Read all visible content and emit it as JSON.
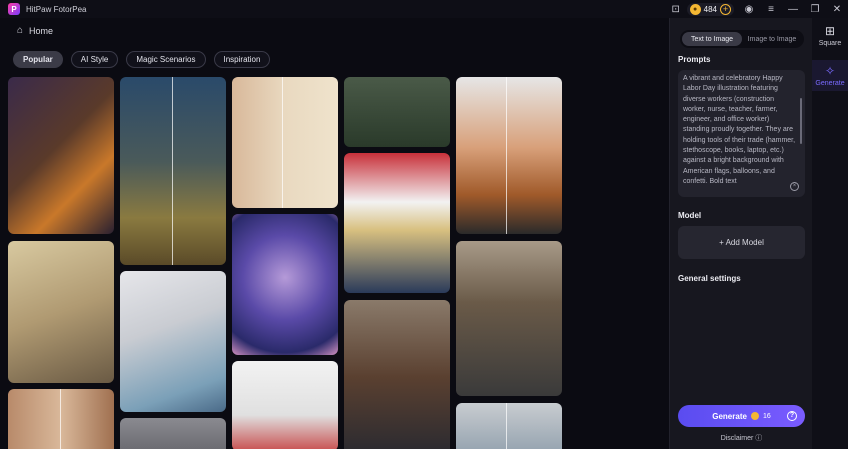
{
  "app": {
    "title": "HitPaw FotorPea",
    "logo_letter": "P"
  },
  "titlebar": {
    "coins": "484",
    "plus": "+",
    "icons": [
      "gamepad-icon",
      "coin-icon",
      "add-coins-icon",
      "account-icon",
      "menu-icon",
      "minimize-icon",
      "restore-icon",
      "close-icon"
    ],
    "gamepad_glyph": "⊡",
    "account_glyph": "◉",
    "menu_glyph": "≡",
    "minimize_glyph": "—",
    "restore_glyph": "❐",
    "close_glyph": "✕"
  },
  "nav": {
    "home_label": "Home",
    "home_glyph": "⌂"
  },
  "tabs": [
    {
      "label": "Popular",
      "active": true
    },
    {
      "label": "AI Style",
      "active": false
    },
    {
      "label": "Magic Scenarios",
      "active": false
    },
    {
      "label": "Inspiration",
      "active": false
    }
  ],
  "panel": {
    "modes": [
      {
        "label": "Text to Image",
        "active": true
      },
      {
        "label": "Image to Image",
        "active": false
      }
    ],
    "prompts_label": "Prompts",
    "prompt_text": "A vibrant and celebratory Happy Labor Day illustration featuring diverse workers (construction worker, nurse, teacher, farmer, engineer, and office worker) standing proudly together. They are holding tools of their trade (hammer, stethoscope, books, laptop, etc.) against a bright background with American flags, balloons, and confetti. Bold text",
    "clear_glyph": "×",
    "model_label": "Model",
    "add_model_label": "+ Add Model",
    "general_settings_label": "General settings",
    "generate_label": "Generate",
    "generate_cost": "16",
    "help_glyph": "?",
    "disclaimer_label": "Disclaimer ⓘ"
  },
  "rail": [
    {
      "label": "Square",
      "glyph": "⊞",
      "active": false
    },
    {
      "label": "Generate",
      "glyph": "✧",
      "active": true
    }
  ],
  "colors": {
    "accent": "#6f5cff",
    "coin": "#f4b733",
    "background": "#0b0b12",
    "panel": "#17171f"
  }
}
